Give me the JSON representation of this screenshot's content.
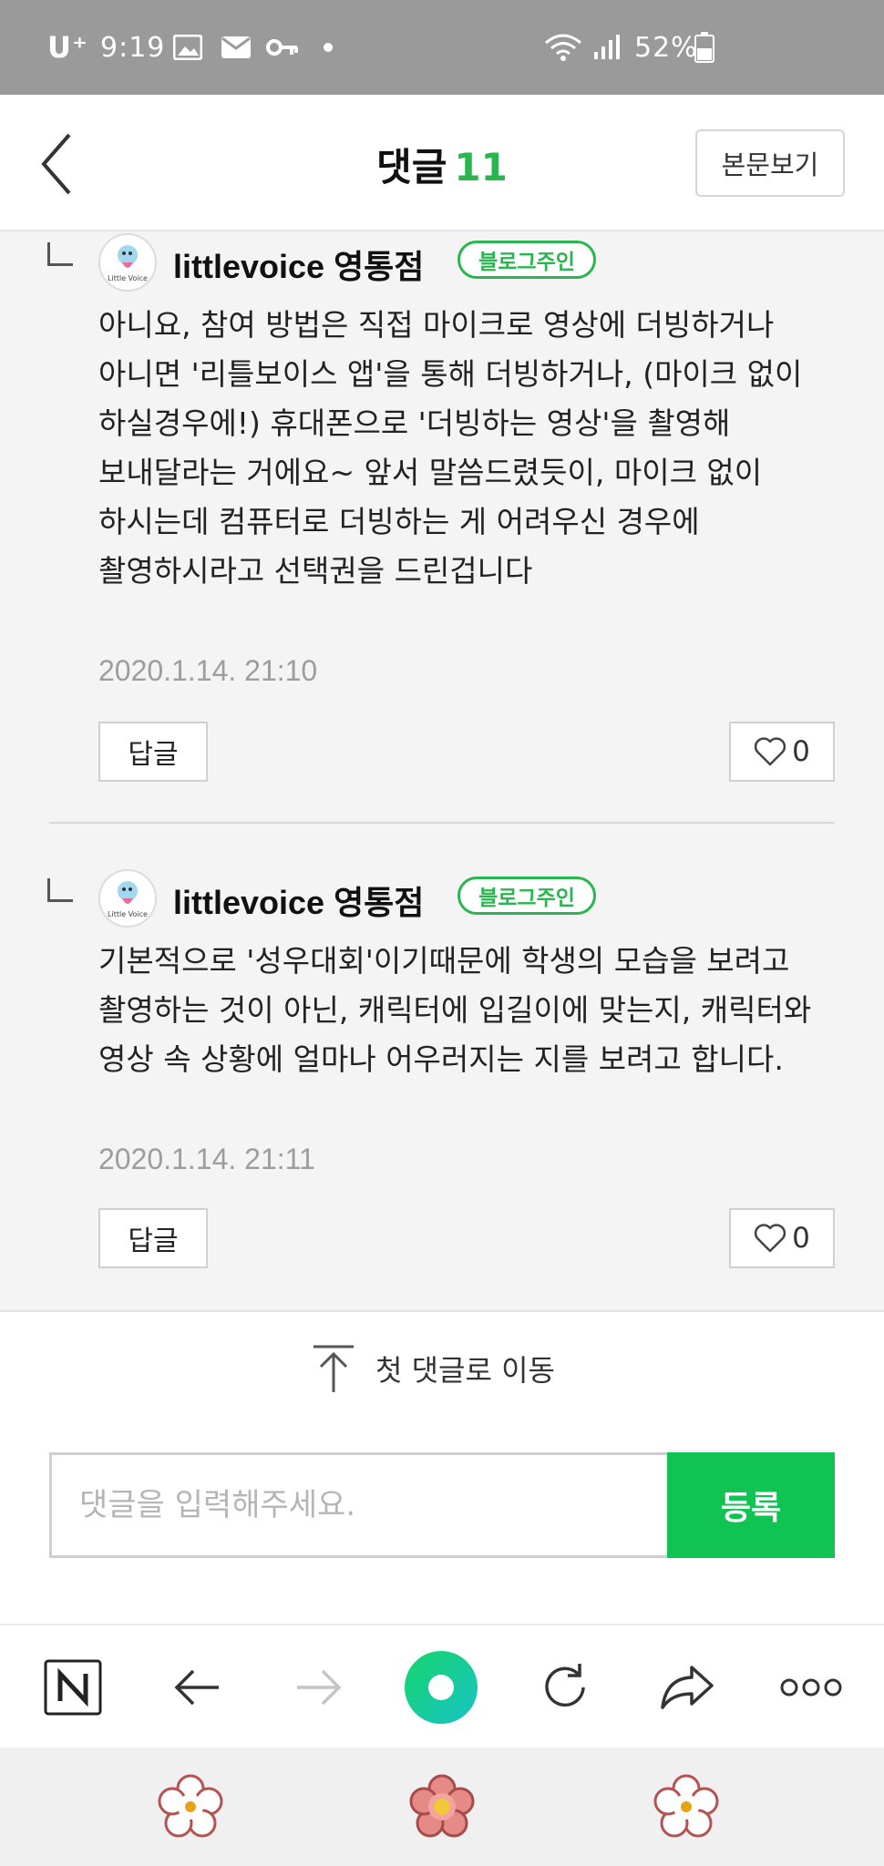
{
  "status_bar": {
    "carrier": "U⁺",
    "time": "9:19",
    "battery": "52%",
    "icons": [
      "image-icon",
      "mail-icon",
      "key-icon",
      "dot-icon",
      "wifi-icon",
      "signal-icon",
      "battery-icon"
    ]
  },
  "header": {
    "title": "댓글",
    "count": "11",
    "view_post_label": "본문보기"
  },
  "comments": [
    {
      "author": "littlevoice 영통점",
      "badge": "블로그주인",
      "text": "아니요, 참여 방법은 직접 마이크로 영상에 더빙하거나 아니면 '리틀보이스 앱'을 통해 더빙하거나, (마이크 없이 하실경우에!) 휴대폰으로 '더빙하는 영상'을 촬영해 보내달라는 거에요~ 앞서 말씀드렸듯이, 마이크 없이 하시는데 컴퓨터로 더빙하는 게 어려우신 경우에 촬영하시라고 선택권을 드린겁니다",
      "timestamp": "2020.1.14. 21:10",
      "reply_label": "답글",
      "likes": "0"
    },
    {
      "author": "littlevoice 영통점",
      "badge": "블로그주인",
      "text": "기본적으로 '성우대회'이기때문에 학생의 모습을 보려고 촬영하는 것이 아닌, 캐릭터에 입길이에 맞는지, 캐릭터와 영상 속 상황에 얼마나 어우러지는 지를 보려고 합니다.",
      "timestamp": "2020.1.14. 21:11",
      "reply_label": "답글",
      "likes": "0"
    }
  ],
  "go_to_first": {
    "label": "첫 댓글로 이동"
  },
  "comment_form": {
    "placeholder": "댓글을 입력해주세요.",
    "submit_label": "등록"
  },
  "colors": {
    "accent_green": "#2ab64f",
    "submit_green": "#11c353",
    "status_bar": "#9a9a9a"
  }
}
